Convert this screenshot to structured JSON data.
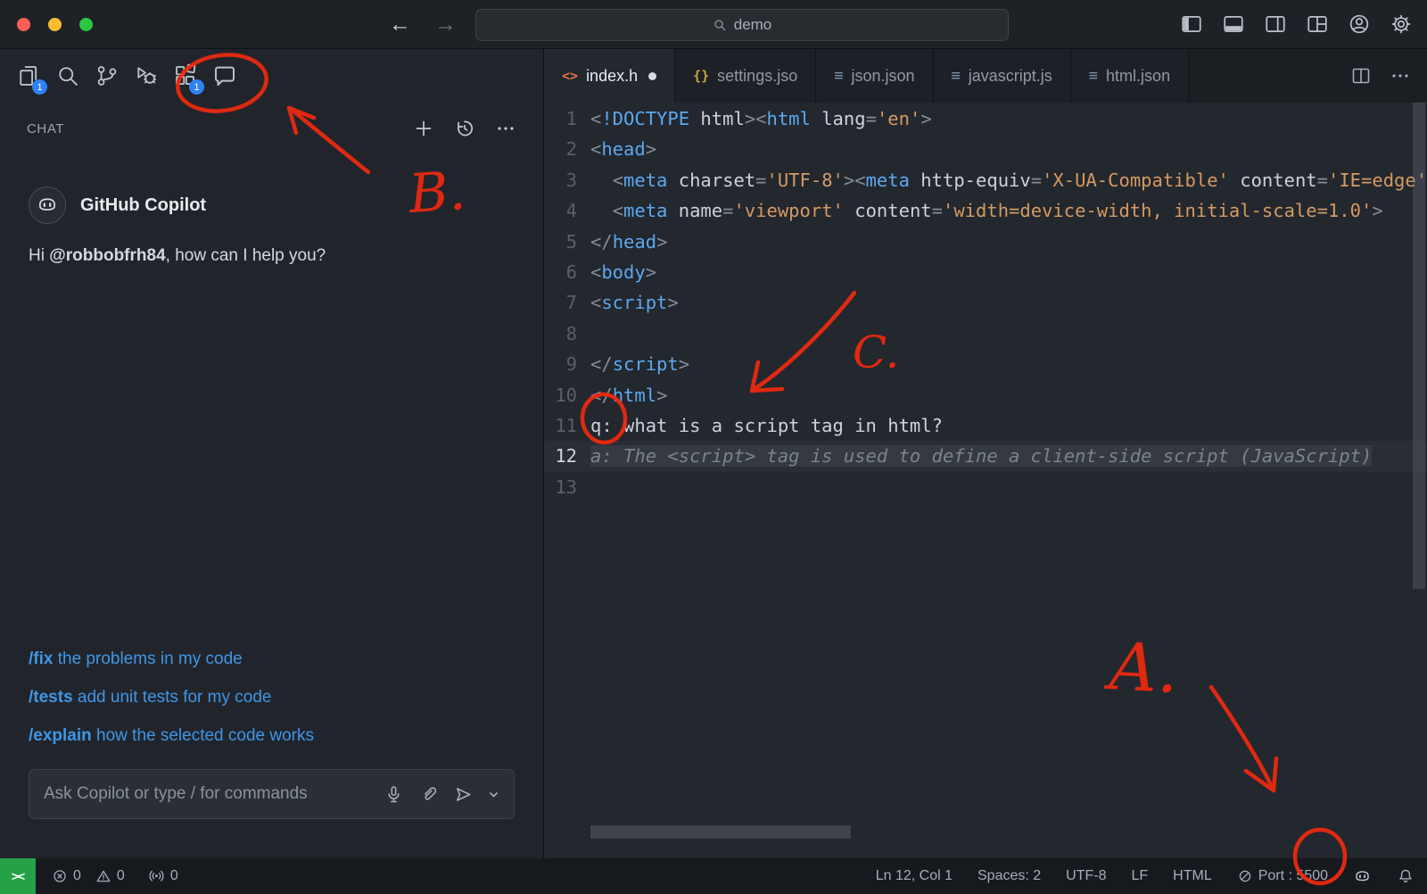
{
  "titlebar": {
    "search_value": "demo"
  },
  "activity_bar": {
    "explorer_badge": "1",
    "extensions_badge": "1"
  },
  "chat": {
    "panel_title": "CHAT",
    "provider_name": "GitHub Copilot",
    "greeting_prefix": "Hi ",
    "greeting_user": "@robbobfrh84",
    "greeting_suffix": ", how can I help you?",
    "commands": [
      {
        "cmd": "/fix",
        "desc": " the problems in my code"
      },
      {
        "cmd": "/tests",
        "desc": " add unit tests for my code"
      },
      {
        "cmd": "/explain",
        "desc": " how the selected code works"
      }
    ],
    "input_placeholder": "Ask Copilot or type / for commands"
  },
  "editor": {
    "tabs": [
      {
        "label": "index.h",
        "icon": "html",
        "modified": true,
        "active": true
      },
      {
        "label": "settings.jso",
        "icon": "braces",
        "modified": false,
        "active": false
      },
      {
        "label": "json.json",
        "icon": "lines",
        "modified": false,
        "active": false
      },
      {
        "label": "javascript.js",
        "icon": "lines",
        "modified": false,
        "active": false
      },
      {
        "label": "html.json",
        "icon": "lines",
        "modified": false,
        "active": false
      }
    ],
    "lines": [
      {
        "n": "1",
        "tokens": [
          [
            "p",
            "<"
          ],
          [
            "kw",
            "!DOCTYPE"
          ],
          [
            "fg",
            " html"
          ],
          [
            "p",
            "><"
          ],
          [
            "tag",
            "html"
          ],
          [
            "fg",
            " lang"
          ],
          [
            "p",
            "="
          ],
          [
            "str",
            "'en'"
          ],
          [
            "p",
            ">"
          ]
        ]
      },
      {
        "n": "2",
        "tokens": [
          [
            "p",
            "<"
          ],
          [
            "tag",
            "head"
          ],
          [
            "p",
            ">"
          ]
        ]
      },
      {
        "n": "3",
        "tokens": [
          [
            "fg",
            "  "
          ],
          [
            "p",
            "<"
          ],
          [
            "tag",
            "meta"
          ],
          [
            "fg",
            " charset"
          ],
          [
            "p",
            "="
          ],
          [
            "str",
            "'UTF-8'"
          ],
          [
            "p",
            "><"
          ],
          [
            "tag",
            "meta"
          ],
          [
            "fg",
            " http-equiv"
          ],
          [
            "p",
            "="
          ],
          [
            "str",
            "'X-UA-Compatible'"
          ],
          [
            "fg",
            " content"
          ],
          [
            "p",
            "="
          ],
          [
            "str",
            "'IE=edge'"
          ],
          [
            "p",
            ">"
          ]
        ]
      },
      {
        "n": "4",
        "tokens": [
          [
            "fg",
            "  "
          ],
          [
            "p",
            "<"
          ],
          [
            "tag",
            "meta"
          ],
          [
            "fg",
            " name"
          ],
          [
            "p",
            "="
          ],
          [
            "str",
            "'viewport'"
          ],
          [
            "fg",
            " content"
          ],
          [
            "p",
            "="
          ],
          [
            "str",
            "'width=device-width, initial-scale=1.0'"
          ],
          [
            "p",
            ">"
          ]
        ]
      },
      {
        "n": "5",
        "tokens": [
          [
            "p",
            "</"
          ],
          [
            "tag",
            "head"
          ],
          [
            "p",
            ">"
          ]
        ]
      },
      {
        "n": "6",
        "tokens": [
          [
            "p",
            "<"
          ],
          [
            "tag",
            "body"
          ],
          [
            "p",
            ">"
          ]
        ]
      },
      {
        "n": "7",
        "tokens": [
          [
            "p",
            "<"
          ],
          [
            "tag",
            "script"
          ],
          [
            "p",
            ">"
          ]
        ]
      },
      {
        "n": "8",
        "tokens": []
      },
      {
        "n": "9",
        "tokens": [
          [
            "p",
            "</"
          ],
          [
            "tag",
            "script"
          ],
          [
            "p",
            ">"
          ]
        ]
      },
      {
        "n": "10",
        "tokens": [
          [
            "p",
            "</"
          ],
          [
            "tag",
            "html"
          ],
          [
            "p",
            ">"
          ]
        ]
      },
      {
        "n": "11",
        "tokens": [
          [
            "fg",
            "q: what is a script tag in html?"
          ]
        ]
      },
      {
        "n": "12",
        "current": true,
        "tokens": [
          [
            "ghost",
            "a: The <script> tag is used to define a client-side script (JavaScript)"
          ]
        ]
      },
      {
        "n": "13",
        "tokens": []
      }
    ]
  },
  "status_bar": {
    "remote_label": "><",
    "errors": "0",
    "warnings": "0",
    "broadcast_count": "0",
    "cursor_position": "Ln 12, Col 1",
    "indentation": "Spaces: 2",
    "encoding": "UTF-8",
    "eol": "LF",
    "language": "HTML",
    "port": "Port : 5500"
  },
  "annotations": {
    "letter_a": "A.",
    "letter_b": "B.",
    "letter_c": "C."
  },
  "colors": {
    "annotation_red": "#ee2a10",
    "badge_blue": "#2f81f7",
    "remote_green": "#27a148",
    "link_blue": "#3f96e8",
    "tag_blue": "#5ca8ef",
    "string_orange": "#d49a62"
  }
}
